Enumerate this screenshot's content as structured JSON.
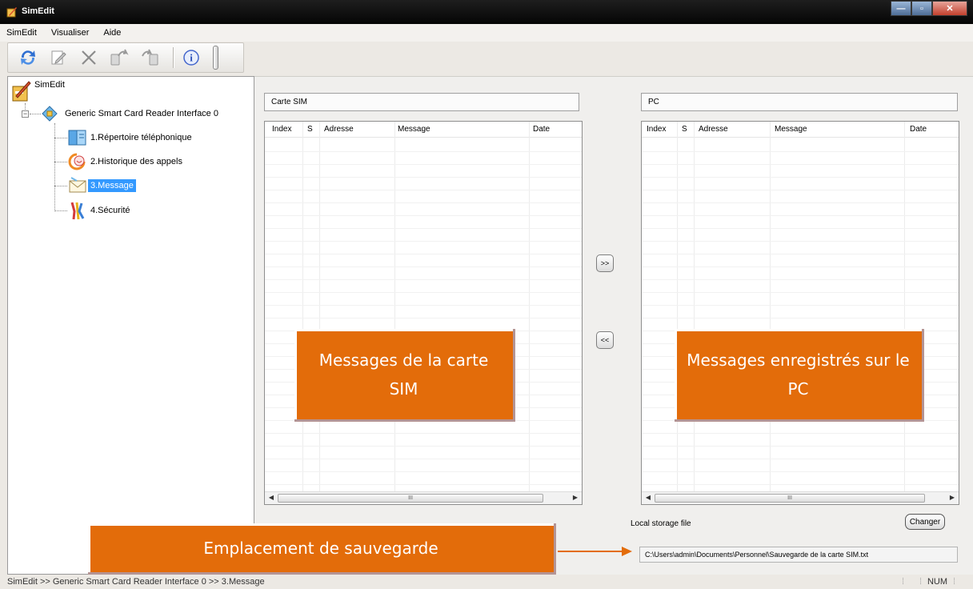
{
  "window": {
    "title": "SimEdit"
  },
  "menu": [
    "SimEdit",
    "Visualiser",
    "Aide"
  ],
  "toolbar": {
    "icons": [
      "refresh-icon",
      "edit-icon",
      "delete-icon",
      "export-icon",
      "import-icon",
      "info-icon"
    ]
  },
  "tree": {
    "root": "SimEdit",
    "reader": "Generic Smart Card Reader Interface 0",
    "items": [
      "1.Répertoire téléphonique",
      "2.Historique des appels",
      "3.Message",
      "4.Sécurité"
    ],
    "selected_index": 2
  },
  "sim_panel": {
    "title": "Carte SIM",
    "columns": [
      "Index",
      "S",
      "Adresse",
      "Message",
      "Date"
    ],
    "scroll_thumb": "III"
  },
  "pc_panel": {
    "title": "PC",
    "columns": [
      "Index",
      "S",
      "Adresse",
      "Message",
      "Date"
    ],
    "scroll_thumb": "III"
  },
  "transfer": {
    "to_pc": ">>",
    "to_sim": "<<"
  },
  "storage": {
    "label": "Local storage file",
    "change_button": "Changer",
    "path": "C:\\Users\\admin\\Documents\\Personnel\\Sauvegarde de la carte SIM.txt"
  },
  "callouts": {
    "sim": "Messages de la carte SIM",
    "pc": "Messages enregistrés sur le PC",
    "save_location": "Emplacement de sauvegarde"
  },
  "statusbar": {
    "breadcrumb": "SimEdit  >>  Generic Smart Card Reader Interface 0  >>  3.Message",
    "num": "NUM"
  },
  "colors": {
    "callout": "#e36c0a",
    "selection": "#3399ff"
  }
}
